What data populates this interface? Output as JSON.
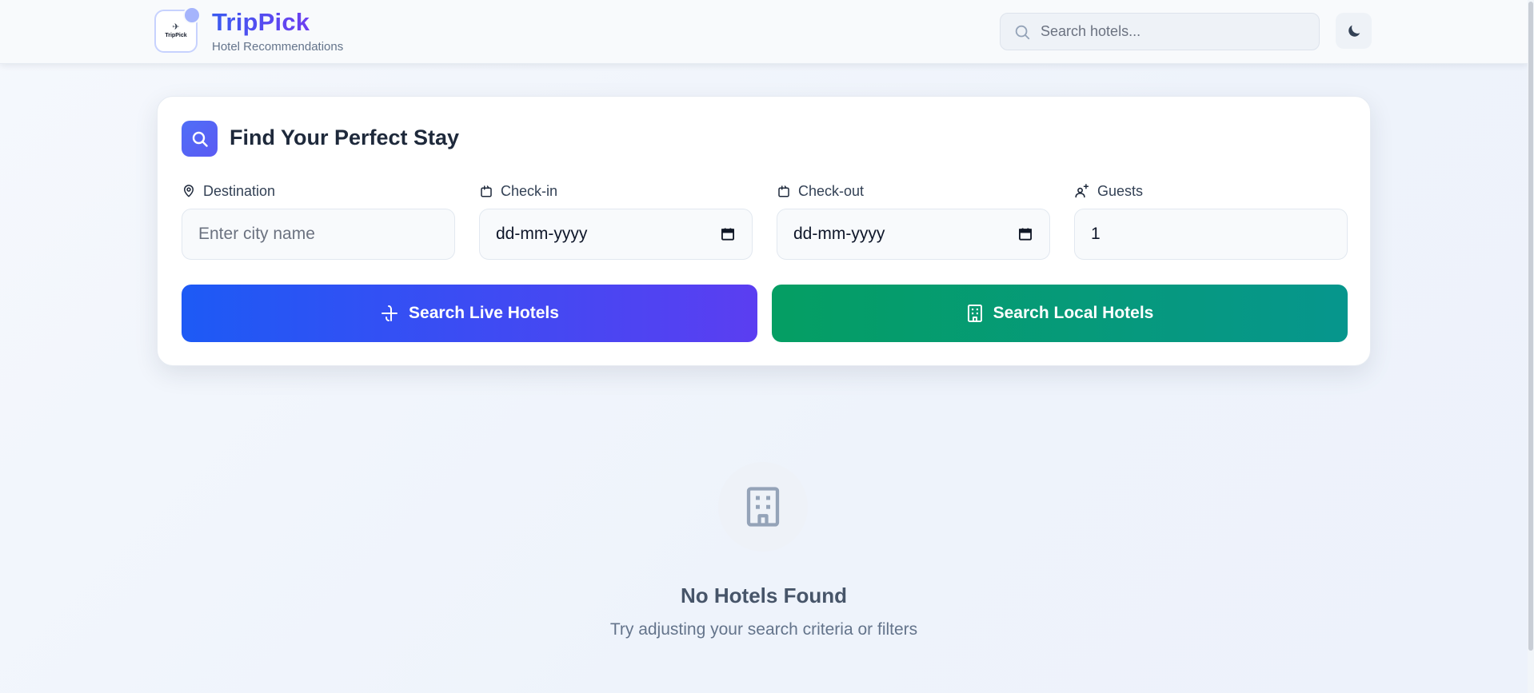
{
  "header": {
    "logo_mark": "✈",
    "logo_text": "TripPick",
    "brand_name": "TripPick",
    "brand_subtitle": "Hotel Recommendations",
    "search_placeholder": "Search hotels...",
    "search_icon": "search-icon",
    "theme_icon": "moon-icon"
  },
  "search_card": {
    "title": "Find Your Perfect Stay",
    "title_icon": "search-icon",
    "fields": {
      "destination": {
        "label": "Destination",
        "placeholder": "Enter city name",
        "icon": "map-pin-icon"
      },
      "checkin": {
        "label": "Check-in",
        "value": "dd-mm-yyyy",
        "icon": "calendar-icon"
      },
      "checkout": {
        "label": "Check-out",
        "value": "dd-mm-yyyy",
        "icon": "calendar-icon"
      },
      "guests": {
        "label": "Guests",
        "value": "1",
        "icon": "users-icon"
      }
    },
    "buttons": {
      "live": {
        "label": "Search Live Hotels",
        "icon": "plane-icon",
        "color": "#1d5af5"
      },
      "local": {
        "label": "Search Local Hotels",
        "icon": "building-icon",
        "color": "#059e63"
      }
    }
  },
  "empty_state": {
    "icon": "building-icon",
    "title": "No Hotels Found",
    "subtitle": "Try adjusting your search criteria or filters"
  },
  "colors": {
    "brand": "#4f46e5",
    "primary": "#1d5af5",
    "success": "#059e63",
    "text": "#1e293b",
    "muted": "#64748b"
  }
}
